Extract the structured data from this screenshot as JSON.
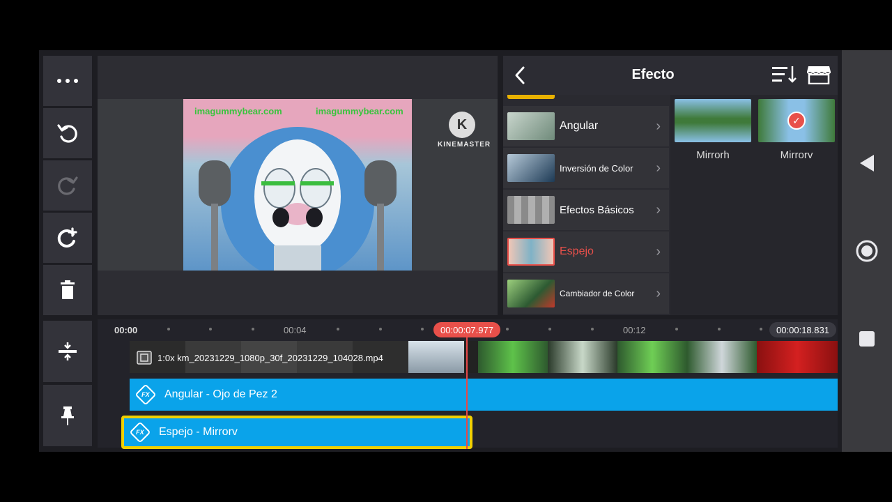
{
  "preview": {
    "watermark_left": "imagummybear.com",
    "watermark_right": "imagummybear.com",
    "brand": "KINEMASTER",
    "brand_initial": "K"
  },
  "effect_panel": {
    "title": "Efecto",
    "categories": [
      {
        "label": "Angular",
        "active": false,
        "thumb_color": "#6f8a7a"
      },
      {
        "label": "Inversión de Color",
        "active": false,
        "thumb_color": "#3a5d78"
      },
      {
        "label": "Efectos Básicos",
        "active": false,
        "thumb_color": "#9a9a9a"
      },
      {
        "label": "Espejo",
        "active": true,
        "thumb_color": "#e9a38f"
      },
      {
        "label": "Cambiador de Color",
        "active": false,
        "thumb_color": "#3c6b3e"
      }
    ],
    "effects": [
      {
        "label": "Mirrorh",
        "selected": false
      },
      {
        "label": "Mirrorv",
        "selected": true
      }
    ]
  },
  "timeline": {
    "ruler": [
      "00:00",
      "00:04",
      "00:12"
    ],
    "current_time": "00:00:07.977",
    "total_time": "00:00:18.831",
    "clip_label": "1:0x km_20231229_1080p_30f_20231229_104028.mp4",
    "fx_tracks": [
      {
        "label": "Angular - Ojo de Pez 2"
      },
      {
        "label": "Espejo - Mirrorv"
      }
    ]
  },
  "colors": {
    "accent": "#e8504a",
    "fx_track": "#0aa3ea",
    "selection": "#f0d000"
  }
}
